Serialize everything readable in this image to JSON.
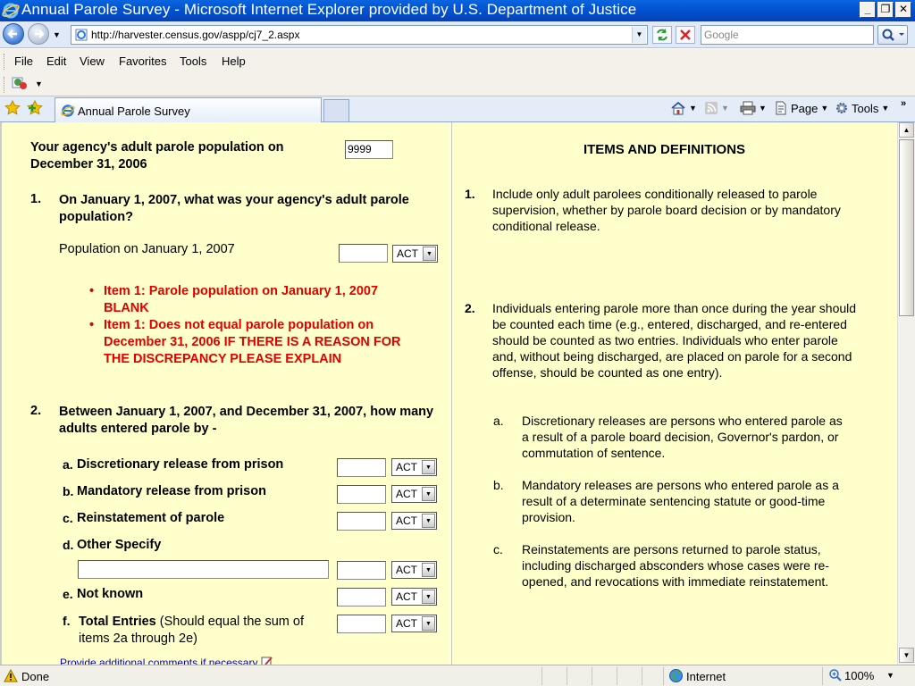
{
  "window": {
    "title": "Annual Parole Survey - Microsoft Internet Explorer provided by U.S. Department of Justice"
  },
  "address": {
    "url": "http://harvester.census.gov/aspp/cj7_2.aspx"
  },
  "search": {
    "placeholder": "Google"
  },
  "menu": [
    "File",
    "Edit",
    "View",
    "Favorites",
    "Tools",
    "Help"
  ],
  "tab": {
    "label": "Annual Parole Survey"
  },
  "commands": {
    "page": "Page",
    "tools": "Tools"
  },
  "form": {
    "header_label": "Your agency's adult parole population on December 31, 2006",
    "header_value": "9999",
    "q1": {
      "num": "1.",
      "text": "On January 1, 2007, what was your agency's adult parole population?",
      "field_label": "Population on January 1, 2007",
      "select": "ACT",
      "errors": [
        "Item 1: Parole population on January 1, 2007 BLANK",
        "Item 1: Does not equal parole population on December 31, 2006 IF THERE IS A REASON FOR THE DISCREPANCY PLEASE EXPLAIN"
      ]
    },
    "q2": {
      "num": "2.",
      "text": "Between January 1, 2007, and December 31, 2007, how many adults entered parole by -",
      "items": [
        {
          "letter": "a.",
          "label": "Discretionary release from prison",
          "select": "ACT"
        },
        {
          "letter": "b.",
          "label": "Mandatory release from prison",
          "select": "ACT"
        },
        {
          "letter": "c.",
          "label": "Reinstatement of parole",
          "select": "ACT"
        },
        {
          "letter": "d.",
          "label": "Other Specify",
          "select": "ACT"
        },
        {
          "letter": "e.",
          "label": "Not known",
          "select": "ACT"
        }
      ],
      "total": {
        "letter": "f.",
        "label": "Total Entries",
        "note": "(Should equal the sum of items 2a through 2e)",
        "select": "ACT"
      }
    },
    "comments_link": "Provide additional comments if necessary"
  },
  "definitions": {
    "heading": "ITEMS AND DEFINITIONS",
    "d1": {
      "num": "1.",
      "text": "Include only adult parolees conditionally released to parole supervision, whether by parole board decision or by mandatory conditional release."
    },
    "d2": {
      "num": "2.",
      "text": "Individuals entering parole more than once during the year should be counted each time (e.g., entered, discharged, and re-entered should be counted as two entries. Individuals who enter parole and, without being discharged, are placed on parole for a second offense, should be counted as one entry)."
    },
    "d2a": {
      "letter": "a.",
      "text": "Discretionary releases are persons who entered parole as a result of a parole board decision, Governor's pardon, or commutation of sentence."
    },
    "d2b": {
      "letter": "b.",
      "text": "Mandatory releases are persons who entered parole as a result of a determinate sentencing statute or good-time provision."
    },
    "d2c": {
      "letter": "c.",
      "text": "Reinstatements are persons returned to parole status, including discharged absconders whose cases were re-opened, and revocations with immediate reinstatement."
    }
  },
  "status": {
    "left": "Done",
    "zone": "Internet",
    "zoom": "100%"
  }
}
